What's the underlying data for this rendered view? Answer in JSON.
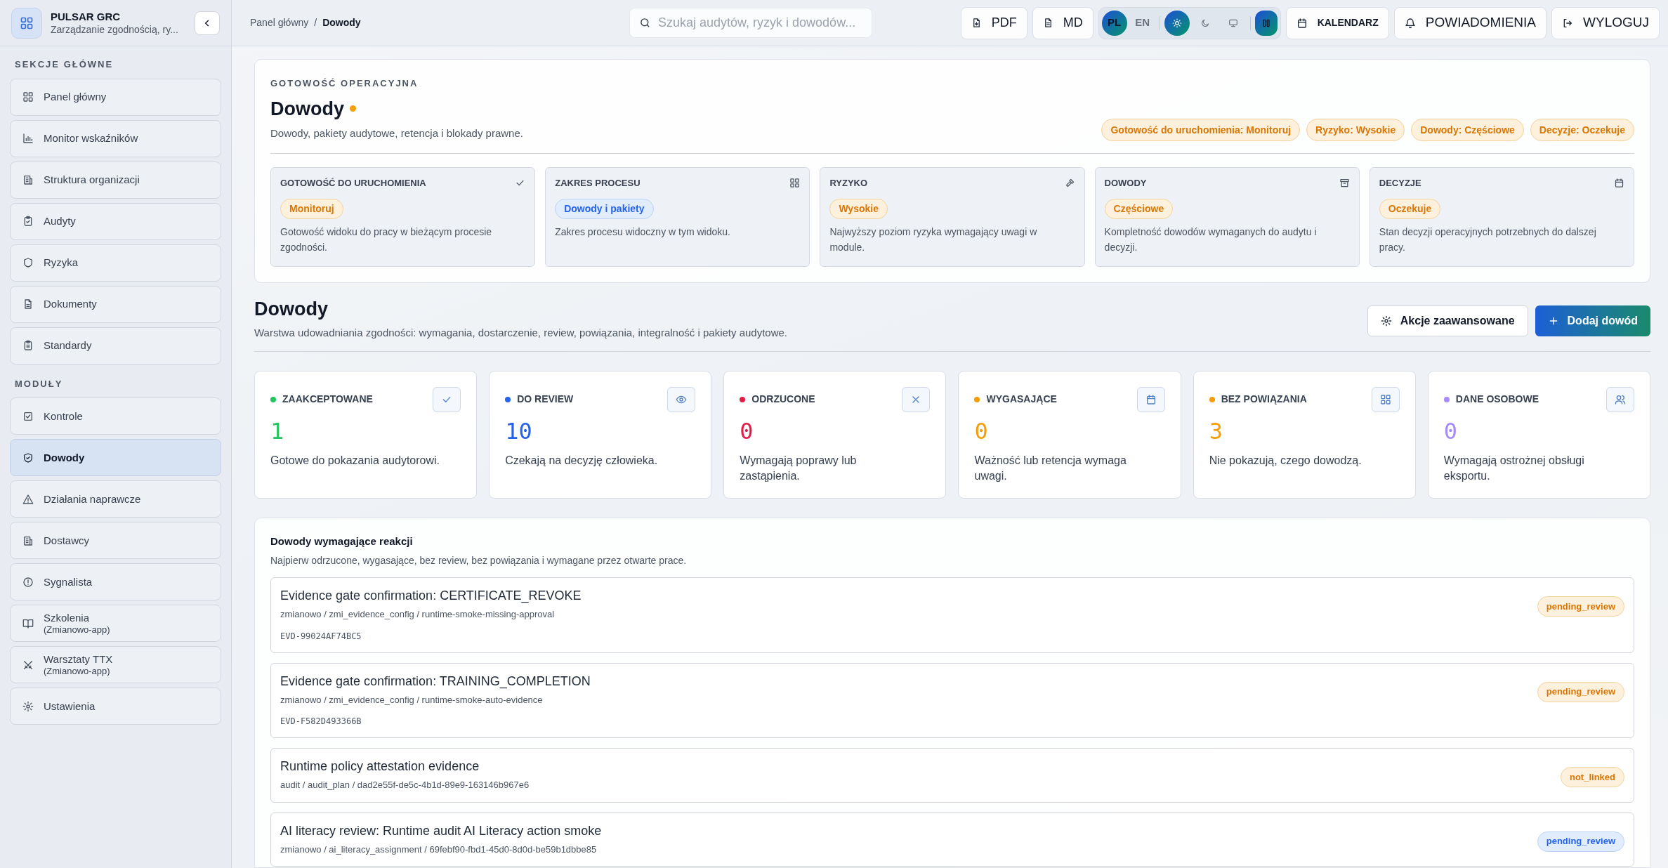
{
  "app": {
    "name": "PULSAR GRC",
    "subtitle": "Zarządzanie zgodnością, ry..."
  },
  "breadcrumb": {
    "separator": "/",
    "items": [
      {
        "label": "Panel główny",
        "current": false
      },
      {
        "label": "Dowody",
        "current": true
      }
    ]
  },
  "search": {
    "placeholder": "Szukaj audytów, ryzyk i dowodów..."
  },
  "toolbar": {
    "exports": [
      "PDF",
      "MD"
    ],
    "languages": [
      {
        "label": "PL",
        "selected": true
      },
      {
        "label": "EN",
        "selected": false
      }
    ],
    "themes": [
      {
        "selected": true
      },
      {
        "selected": false
      },
      {
        "selected": false
      }
    ],
    "actions": [
      {
        "label": "KALENDARZ",
        "kind": "bold"
      },
      {
        "label": "POWIADOMIENIA",
        "kind": "plain"
      },
      {
        "label": "WYLOGUJ",
        "kind": "plain"
      }
    ]
  },
  "sidebar": {
    "sections": [
      {
        "title": "SEKCJE GŁÓWNE",
        "items": [
          {
            "label": "Panel główny",
            "selected": false
          },
          {
            "label": "Monitor wskaźników",
            "selected": false
          },
          {
            "label": "Struktura organizacji",
            "selected": false
          },
          {
            "label": "Audyty",
            "selected": false
          },
          {
            "label": "Ryzyka",
            "selected": false
          },
          {
            "label": "Dokumenty",
            "selected": false
          },
          {
            "label": "Standardy",
            "selected": false
          }
        ]
      },
      {
        "title": "MODUŁY",
        "items": [
          {
            "label": "Kontrole",
            "selected": false
          },
          {
            "label": "Dowody",
            "selected": true
          },
          {
            "label": "Działania naprawcze",
            "selected": false
          },
          {
            "label": "Dostawcy",
            "selected": false
          },
          {
            "label": "Sygnalista",
            "selected": false
          },
          {
            "label": "Szkolenia",
            "sublabel": "(Zmianowo-app)",
            "selected": false
          },
          {
            "label": "Warsztaty TTX",
            "sublabel": "(Zmianowo-app)",
            "selected": false
          },
          {
            "label": "Ustawienia",
            "selected": false
          }
        ]
      }
    ]
  },
  "readiness": {
    "eyebrow": "GOTOWOŚĆ OPERACYJNA",
    "title": "Dowody",
    "description": "Dowody, pakiety audytowe, retencja i blokady prawne.",
    "badges": [
      {
        "text": "Gotowość do uruchomienia: Monitoruj",
        "kind": "warning"
      },
      {
        "text": "Ryzyko: Wysokie",
        "kind": "warning"
      },
      {
        "text": "Dowody: Częściowe",
        "kind": "warning"
      },
      {
        "text": "Decyzje: Oczekuje",
        "kind": "warning"
      }
    ],
    "cards": [
      {
        "title": "GOTOWOŚĆ DO URUCHOMIENIA",
        "badge": {
          "text": "Monitoruj",
          "kind": "warning"
        },
        "description": "Gotowość widoku do pracy w bieżącym procesie zgodności."
      },
      {
        "title": "ZAKRES PROCESU",
        "badge": {
          "text": "Dowody i pakiety",
          "kind": "info"
        },
        "description": "Zakres procesu widoczny w tym widoku."
      },
      {
        "title": "RYZYKO",
        "badge": {
          "text": "Wysokie",
          "kind": "warning"
        },
        "description": "Najwyższy poziom ryzyka wymagający uwagi w module."
      },
      {
        "title": "DOWODY",
        "badge": {
          "text": "Częściowe",
          "kind": "warning"
        },
        "description": "Kompletność dowodów wymaganych do audytu i decyzji."
      },
      {
        "title": "DECYZJE",
        "badge": {
          "text": "Oczekuje",
          "kind": "warning"
        },
        "description": "Stan decyzji operacyjnych potrzebnych do dalszej pracy."
      }
    ]
  },
  "page": {
    "title": "Dowody",
    "description": "Warstwa udowadniania zgodności: wymagania, dostarczenie, review, powiązania, integralność i pakiety audytowe.",
    "buttons": [
      {
        "label": "Akcje zaawansowane",
        "kind": "secondary"
      },
      {
        "label": "Dodaj dowód",
        "kind": "primary"
      }
    ]
  },
  "stats": [
    {
      "label": "ZAAKCEPTOWANE",
      "value": "1",
      "description": "Gotowe do pokazania audytorowi.",
      "color": "#22c55e"
    },
    {
      "label": "DO REVIEW",
      "value": "10",
      "description": "Czekają na decyzję człowieka.",
      "color": "#2563eb"
    },
    {
      "label": "ODRZUCONE",
      "value": "0",
      "description": "Wymagają poprawy lub zastąpienia.",
      "color": "#e11d48"
    },
    {
      "label": "WYGASAJĄCE",
      "value": "0",
      "description": "Ważność lub retencja wymaga uwagi.",
      "color": "#f59e0b"
    },
    {
      "label": "BEZ POWIĄZANIA",
      "value": "3",
      "description": "Nie pokazują, czego dowodzą.",
      "color": "#f59e0b"
    },
    {
      "label": "DANE OSOBOWE",
      "value": "0",
      "description": "Wymagają ostrożnej obsługi eksportu.",
      "color": "#a78bfa"
    }
  ],
  "attention": {
    "title": "Dowody wymagające reakcji",
    "description": "Najpierw odrzucone, wygasające, bez review, bez powiązania i wymagane przez otwarte prace.",
    "items": [
      {
        "title": "Evidence gate confirmation: CERTIFICATE_REVOKE",
        "path": "zmianowo / zmi_evidence_config / runtime-smoke-missing-approval",
        "code": "EVD-99024AF74BC5",
        "badge": {
          "text": "pending_review",
          "kind": "warning"
        }
      },
      {
        "title": "Evidence gate confirmation: TRAINING_COMPLETION",
        "path": "zmianowo / zmi_evidence_config / runtime-smoke-auto-evidence",
        "code": "EVD-F582D493366B",
        "badge": {
          "text": "pending_review",
          "kind": "warning"
        }
      },
      {
        "title": "Runtime policy attestation evidence",
        "path": "audit / audit_plan / dad2e55f-de5c-4b1d-89e9-163146b967e6",
        "badge": {
          "text": "not_linked",
          "kind": "warning"
        }
      },
      {
        "title": "AI literacy review: Runtime audit AI Literacy action smoke",
        "path": "zmianowo / ai_literacy_assignment / 69febf90-fbd1-45d0-8d0d-be59b1dbbe85",
        "badge": {
          "text": "pending_review",
          "kind": "info"
        }
      }
    ]
  }
}
